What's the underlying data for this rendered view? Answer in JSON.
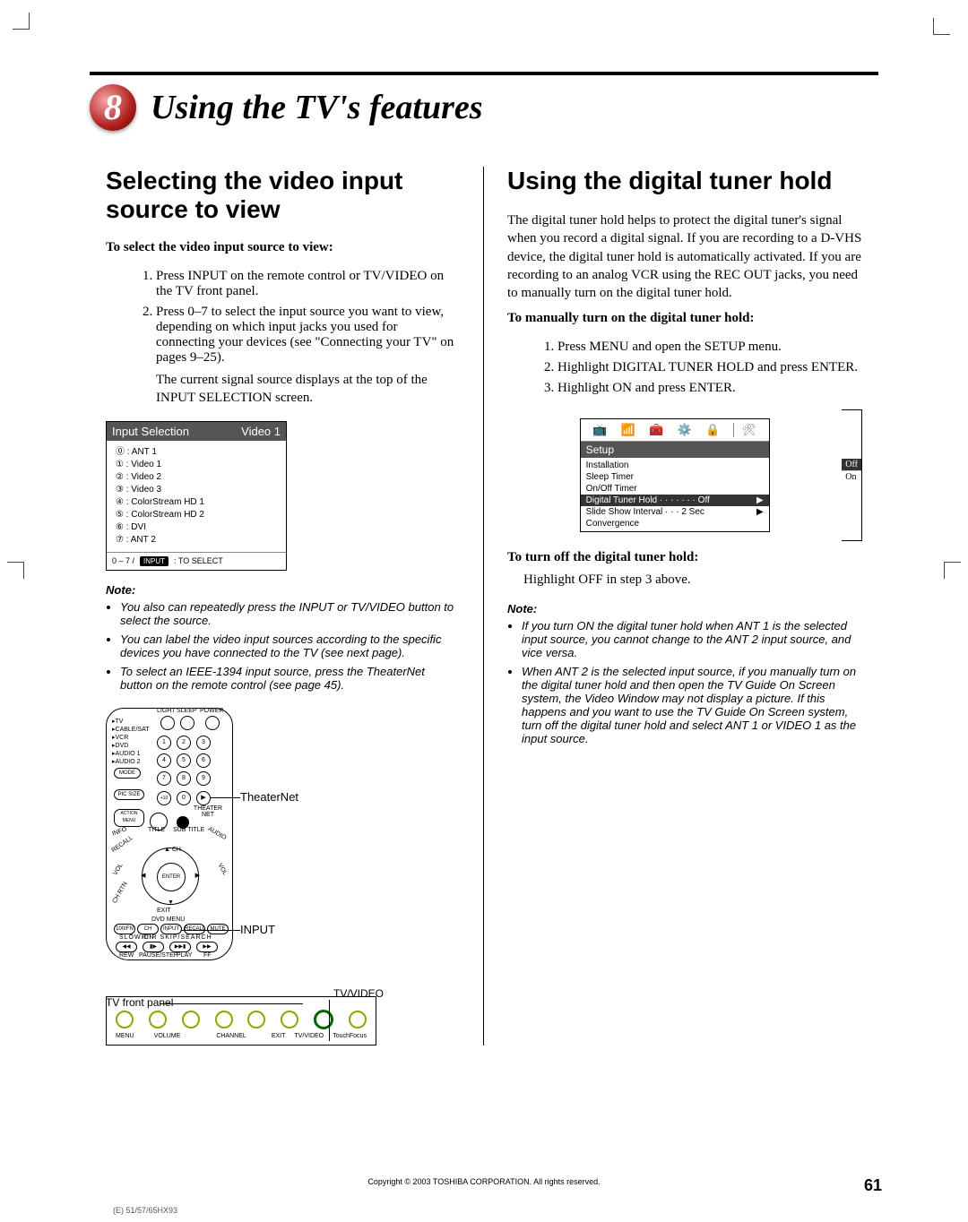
{
  "chapter": {
    "number": "8",
    "title": "Using the TV's features"
  },
  "left": {
    "heading": "Selecting the video input source to view",
    "sub1": "To select the video input source to view:",
    "steps": [
      "Press INPUT on the remote control or TV/VIDEO on the TV front panel.",
      "Press 0–7 to select the input source you want to view, depending on which input jacks you used for connecting your devices (see \"Connecting your TV\" on pages 9–25).",
      "The current signal source displays at the top of the INPUT SELECTION screen."
    ],
    "osd": {
      "title": "Input Selection",
      "current": "Video 1",
      "items": [
        "⓪ : ANT 1",
        "① : Video 1",
        "② : Video 2",
        "③ : Video 3",
        "④ : ColorStream HD 1",
        "⑤ : ColorStream HD 2",
        "⑥ : DVI",
        "⑦ : ANT 2"
      ],
      "footer_prefix": "0 – 7 /",
      "footer_key": "INPUT",
      "footer_rest": " : TO SELECT"
    },
    "note_head": "Note:",
    "notes": [
      "You also can repeatedly press the INPUT or TV/VIDEO button to select the source.",
      "You can label the video input sources according to the specific devices you have connected to the TV (see next page).",
      "To select an IEEE-1394 input source, press the TheaterNet button on the remote control (see page 45)."
    ],
    "remote": {
      "callout1": "TheaterNet",
      "callout2": "INPUT",
      "side_labels": [
        "TV",
        "CABLE/SAT",
        "VCR",
        "DVD",
        "AUDIO 1",
        "AUDIO 2"
      ],
      "top_row": [
        "LIGHT",
        "SLEEP",
        "POWER"
      ],
      "mode": "MODE",
      "picsize": "PIC SIZE",
      "menu": [
        "ACTION",
        "MENU"
      ],
      "zero_row": "+10",
      "theater": "THEATER NET",
      "left_curve": [
        "INFO",
        "RECALL"
      ],
      "right_curve": [
        "TITLE",
        "SUB TITLE",
        "AUDIO"
      ],
      "side_ch": [
        "CH",
        "CH RTN",
        "VOL",
        "EXIT"
      ],
      "dvd_menu": "DVD MENU",
      "bot_row": [
        "100/FN",
        "CH RTN",
        "INPUT",
        "RECALL",
        "MUTE"
      ],
      "transport1": "SLOW/DIR      SKIP/SEARCH",
      "transport2": [
        "REW",
        "PAUSE/STEP",
        "PLAY",
        "FF"
      ],
      "enter": "ENTER"
    },
    "panel": {
      "left_label": "TV front panel",
      "right_label": "TV/VIDEO",
      "buttons": [
        "MENU",
        "VOLUME",
        "VOLUME",
        "CHANNEL",
        "CHANNEL",
        "EXIT",
        "TV/VIDEO",
        "TouchFocus"
      ]
    }
  },
  "right": {
    "heading": "Using the digital tuner hold",
    "intro": "The digital tuner hold helps to protect the digital tuner's signal when you record a digital signal. If you are recording to a D-VHS device, the digital tuner hold is automatically activated. If you are recording to an analog VCR using the REC OUT jacks, you need to manually turn on the digital tuner hold.",
    "sub1": "To manually turn on the digital tuner hold:",
    "steps": [
      "Press MENU and open the SETUP menu.",
      "Highlight DIGITAL TUNER HOLD and press ENTER.",
      "Highlight ON and press ENTER."
    ],
    "osd": {
      "tabs": [
        "📺",
        "📶",
        "🧰",
        "⚙️",
        "🔒",
        "🛠"
      ],
      "section": "Setup",
      "rows": [
        {
          "label": "Installation",
          "val": ""
        },
        {
          "label": "Sleep Timer",
          "val": ""
        },
        {
          "label": "On/Off Timer",
          "val": ""
        },
        {
          "label": "Digital Tuner Hold · · · · · · · Off",
          "val": "",
          "hi": true
        },
        {
          "label": "Slide Show Interval · · · 2 Sec",
          "val": ""
        },
        {
          "label": "Convergence",
          "val": ""
        }
      ],
      "side_off": "Off",
      "side_on": "On"
    },
    "sub2": "To turn off the digital tuner hold:",
    "step_off": "Highlight OFF in step 3 above.",
    "note_head": "Note:",
    "notes": [
      "If you turn ON the digital tuner hold when ANT 1 is the selected input source, you cannot change to the ANT 2 input source, and vice versa.",
      "When ANT 2 is the selected input source, if you manually turn on the digital tuner hold and then open the TV Guide On Screen system, the Video Window may not display a picture. If this happens and you want to use the TV Guide On Screen system, turn off the digital tuner hold and select ANT 1 or VIDEO 1 as the input source."
    ]
  },
  "footer": {
    "copyright": "Copyright © 2003 TOSHIBA CORPORATION. All rights reserved.",
    "page": "61",
    "slug": "(E) 51/57/65HX93"
  }
}
